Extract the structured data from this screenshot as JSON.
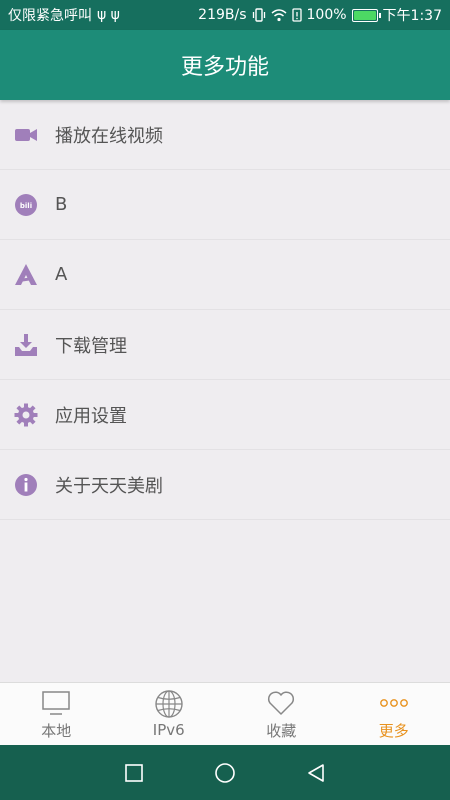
{
  "status_bar": {
    "left_text": "仅限紧急呼叫",
    "usb_glyph": "ψ ψ",
    "net_speed": "219B/s",
    "battery_pct": "100%",
    "time": "下午1:37",
    "colors": {
      "background": "#166f5e",
      "battery_fill": "#4cd964"
    }
  },
  "header": {
    "title": "更多功能",
    "color": "#1d8c78"
  },
  "menu": {
    "icon_color": "#a07fba",
    "items": [
      {
        "label": "播放在线视频",
        "icon": "video-camera-icon"
      },
      {
        "label": "B",
        "icon": "bilibili-icon"
      },
      {
        "label": "A",
        "icon": "acfun-icon"
      },
      {
        "label": "下载管理",
        "icon": "download-tray-icon"
      },
      {
        "label": "应用设置",
        "icon": "gear-icon"
      },
      {
        "label": "关于天天美剧",
        "icon": "info-icon"
      }
    ]
  },
  "tabs": {
    "active_color": "#e8921e",
    "items": [
      {
        "label": "本地",
        "icon": "monitor-icon"
      },
      {
        "label": "IPv6",
        "icon": "globe-icon"
      },
      {
        "label": "收藏",
        "icon": "heart-icon"
      },
      {
        "label": "更多",
        "icon": "more-dots-icon",
        "active": true
      }
    ]
  },
  "nav_bar": {
    "buttons": [
      "recent-apps-icon",
      "home-icon",
      "back-icon"
    ]
  }
}
